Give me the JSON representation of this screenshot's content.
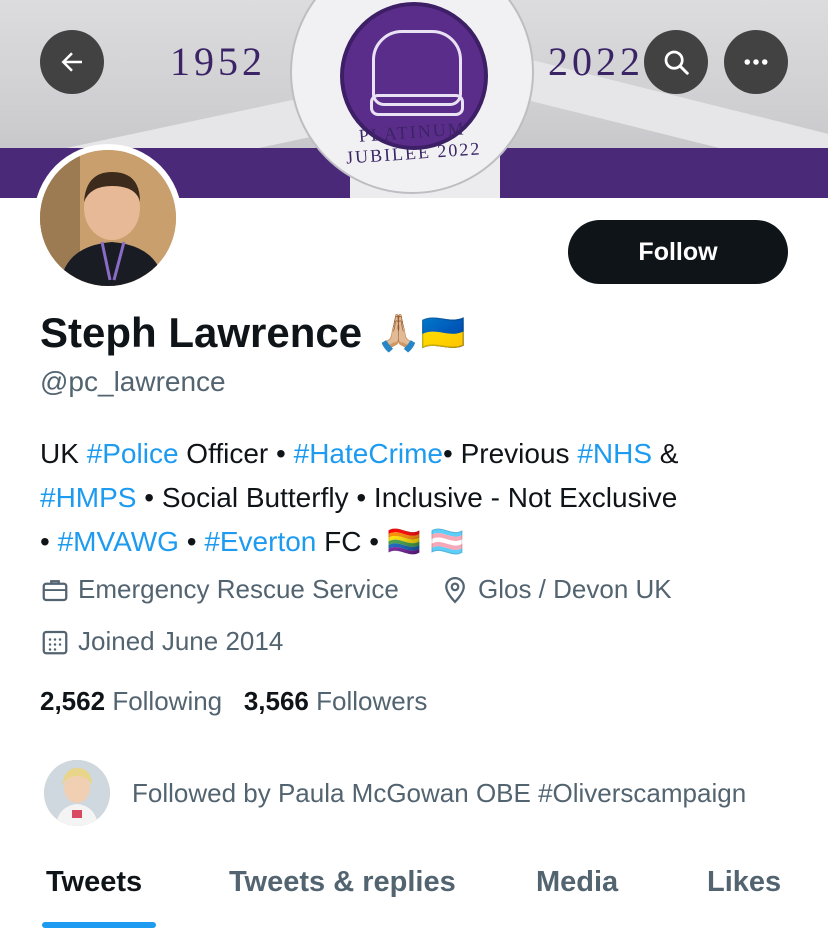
{
  "banner": {
    "year_left": "1952",
    "year_right": "2022",
    "seal_text": "PLATINUM JUBILEE 2022"
  },
  "topbar": {
    "back_icon": "arrow-left-icon",
    "search_icon": "search-icon",
    "more_icon": "more-horizontal-icon"
  },
  "profile": {
    "follow_label": "Follow",
    "name": "Steph Lawrence",
    "name_emojis": "🙏🏼🇺🇦",
    "handle": "@pc_lawrence",
    "bio": {
      "line1": {
        "a": "UK ",
        "b": "#Police",
        "c": " Officer • ",
        "d": "#HateCrime",
        "e": "• Previous ",
        "f": "#NHS",
        "g": " &"
      },
      "line2": {
        "a": "#HMPS",
        "b": " • Social Butterfly • Inclusive - Not Exclusive"
      },
      "line3": {
        "a": "• ",
        "b": "#MVAWG",
        "c": " • ",
        "d": "#Everton",
        "e": " FC • ",
        "f": "🏳️‍🌈 🏳️‍⚧️"
      }
    },
    "category": "Emergency Rescue Service",
    "location": "Glos / Devon UK",
    "joined": "Joined June 2014",
    "following_count": "2,562",
    "following_label": "Following",
    "followers_count": "3,566",
    "followers_label": "Followers",
    "followed_by": "Followed by Paula McGowan OBE #Oliverscampaign"
  },
  "tabs": [
    "Tweets",
    "Tweets & replies",
    "Media",
    "Likes"
  ],
  "colors": {
    "accent": "#1d9bf0",
    "text": "#0f1419",
    "muted": "#536471"
  }
}
